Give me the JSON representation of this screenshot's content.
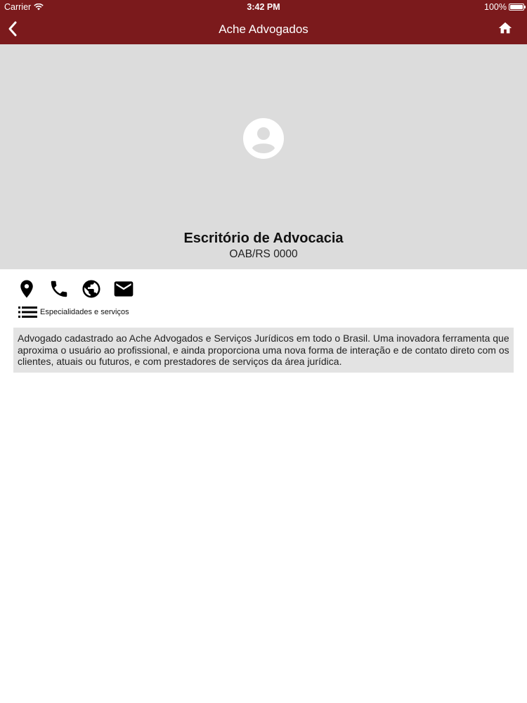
{
  "status_bar": {
    "carrier": "Carrier",
    "wifi_icon": "wifi-icon",
    "time": "3:42 PM",
    "battery_percent": "100%",
    "battery_level": 1.0
  },
  "nav": {
    "title": "Ache Advogados",
    "back_icon": "chevron-left-icon",
    "home_icon": "home-icon"
  },
  "profile": {
    "avatar_icon": "account-circle-icon",
    "name": "Escritório de Advocacia",
    "registration": "OAB/RS 0000"
  },
  "actions": [
    {
      "icon": "location-pin-icon",
      "purpose": "map"
    },
    {
      "icon": "phone-icon",
      "purpose": "call"
    },
    {
      "icon": "globe-icon",
      "purpose": "website"
    },
    {
      "icon": "mail-icon",
      "purpose": "email"
    }
  ],
  "specialties": {
    "icon": "list-icon",
    "label": "Especialidades e serviços"
  },
  "description": "Advogado cadastrado ao Ache Advogados e Serviços Jurídicos em todo o Brasil. Uma inovadora ferramenta que aproxima o usuário ao profissional, e ainda proporciona uma nova forma de interação e de contato direto com os clientes, atuais ou futuros, e com prestadores de serviços da área jurídica.",
  "colors": {
    "brand": "#7b1a1c",
    "hero_background": "#dcdcdc",
    "description_background": "#e3e3e3"
  }
}
